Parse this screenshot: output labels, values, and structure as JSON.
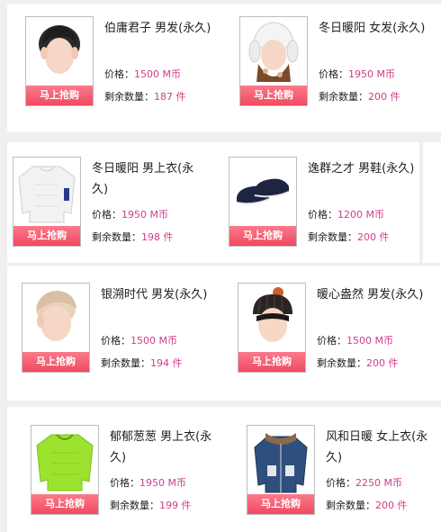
{
  "buy_label": "马上抢购",
  "price_label": "价格：",
  "stock_label": "剩余数量：",
  "items": [
    {
      "name": "伯庸君子 男发(永久)",
      "price": "1500",
      "currency": "M币",
      "stock": "187",
      "unit": "件",
      "icon": "male-hair-icon"
    },
    {
      "name": "冬日暖阳 女发(永久)",
      "price": "1950",
      "currency": "M币",
      "stock": "200",
      "unit": "件",
      "icon": "female-hat-icon"
    },
    {
      "name": "冬日暖阳 男上衣(永久)",
      "price": "1950",
      "currency": "M币",
      "stock": "198",
      "unit": "件",
      "icon": "sweater-icon"
    },
    {
      "name": "逸群之才 男鞋(永久)",
      "price": "1200",
      "currency": "M币",
      "stock": "200",
      "unit": "件",
      "icon": "shoes-icon"
    },
    {
      "name": "银溯时代 男发(永久)",
      "price": "1500",
      "currency": "M币",
      "stock": "194",
      "unit": "件",
      "icon": "silver-hair-icon"
    },
    {
      "name": "暖心盎然 男发(永久)",
      "price": "1500",
      "currency": "M币",
      "stock": "200",
      "unit": "件",
      "icon": "beanie-hair-icon"
    },
    {
      "name": "郁郁葱葱 男上衣(永久)",
      "price": "1950",
      "currency": "M币",
      "stock": "199",
      "unit": "件",
      "icon": "green-sweater-icon"
    },
    {
      "name": "风和日暖 女上衣(永久)",
      "price": "2250",
      "currency": "M币",
      "stock": "200",
      "unit": "件",
      "icon": "denim-jacket-icon"
    }
  ]
}
